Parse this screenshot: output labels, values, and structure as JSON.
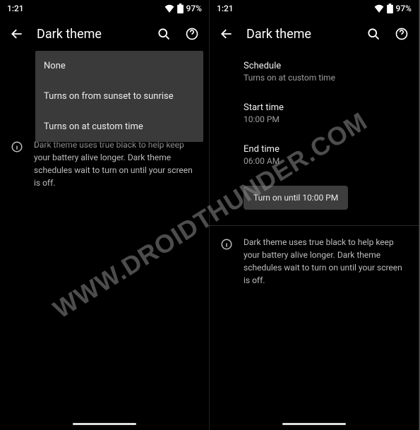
{
  "watermark": "WWW.DROIDTHUNDER.COM",
  "left": {
    "status": {
      "time": "1:21",
      "battery": "97%"
    },
    "header": {
      "title": "Dark theme"
    },
    "popup": {
      "options": [
        {
          "label": "None"
        },
        {
          "label": "Turns on from sunset to sunrise"
        },
        {
          "label": "Turns on at custom time"
        }
      ]
    },
    "info": "Dark theme uses true black to help keep your battery alive longer. Dark theme schedules wait to turn on until your screen is off."
  },
  "right": {
    "status": {
      "time": "1:21",
      "battery": "97%"
    },
    "header": {
      "title": "Dark theme"
    },
    "schedule": {
      "label": "Schedule",
      "value": "Turns on at custom time"
    },
    "start": {
      "label": "Start time",
      "value": "10:00 PM"
    },
    "end": {
      "label": "End time",
      "value": "06:00 AM"
    },
    "toggle": {
      "label": "Turn on until 10:00 PM"
    },
    "info": "Dark theme uses true black to help keep your battery alive longer. Dark theme schedules wait to turn on until your screen is off."
  }
}
